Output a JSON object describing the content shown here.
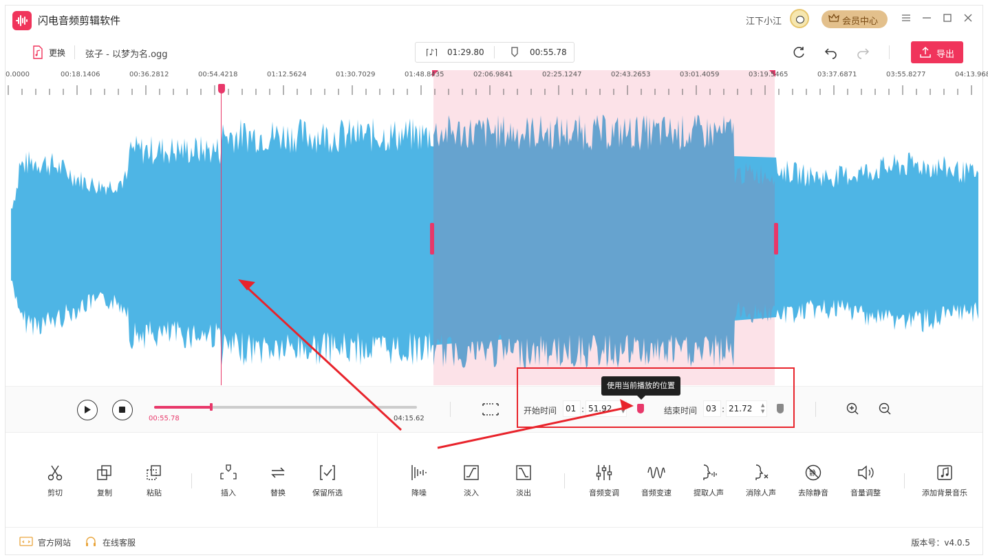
{
  "app": {
    "title": "闪电音频剪辑软件",
    "user_name": "江下小江",
    "vip_label": "会员中心",
    "menu_icon": "menu-icon",
    "minimize_icon": "minimize-icon",
    "maximize_icon": "maximize-icon",
    "close_icon": "close-icon"
  },
  "filebar": {
    "replace_label": "更换",
    "file_name": "弦子 - 以梦为名.ogg",
    "selection_duration": "01:29.80",
    "playhead_time": "00:55.78",
    "export_label": "导出"
  },
  "timeline": {
    "ticks": [
      "0.0000",
      "00:18.1406",
      "00:36.2812",
      "00:54.4218",
      "01:12.5624",
      "01:30.7029",
      "01:48.8435",
      "02:06.9841",
      "02:25.1247",
      "02:43.2653",
      "03:01.4059",
      "03:19.5465",
      "03:37.6871",
      "03:55.8277",
      "04:13.968"
    ],
    "total_duration_s": 255.62,
    "playhead_s": 55.78,
    "selection_start_s": 111.92,
    "selection_end_s": 201.72
  },
  "transport": {
    "current_time": "00:55.78",
    "total_time": "04:15.62",
    "progress": 0.218,
    "start_label": "开始时间",
    "start_min": "01",
    "start_sec": "51.92",
    "end_label": "结束时间",
    "end_min": "03",
    "end_sec": "21.72",
    "colon": ":",
    "tooltip": "使用当前播放的位置"
  },
  "tools": {
    "cut": "剪切",
    "copy": "复制",
    "paste": "粘贴",
    "insert": "插入",
    "replace": "替换",
    "keep_selection": "保留所选",
    "denoise": "降噪",
    "fade_in": "淡入",
    "fade_out": "淡出",
    "pitch": "音频变调",
    "speed": "音频变速",
    "extract_vocal": "提取人声",
    "remove_vocal": "消除人声",
    "remove_silence": "去除静音",
    "volume": "音量调整",
    "add_bgm": "添加背景音乐"
  },
  "footer": {
    "website": "官方网站",
    "support": "在线客服",
    "version": "版本号：v4.0.5"
  },
  "colors": {
    "accent": "#f0345b",
    "waveform": "#4eb5e5",
    "waveform_selected": "#66a3cf",
    "selection_bg": "#fbdde5",
    "highlight": "#e8232b"
  }
}
